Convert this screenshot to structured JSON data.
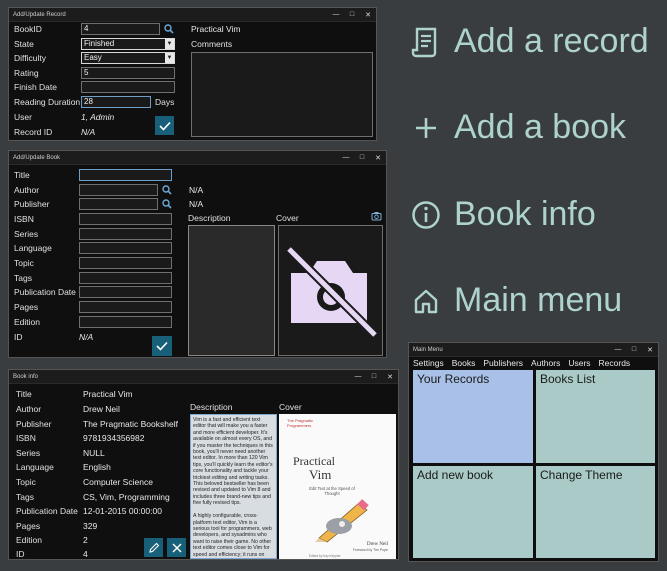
{
  "add_record": {
    "title": "Add/Update Record",
    "labels": {
      "bookid": "BookID",
      "state": "State",
      "difficulty": "Difficulty",
      "rating": "Rating",
      "finish_date": "Finish Date",
      "reading_duration": "Reading Duration",
      "user": "User",
      "record_id": "Record ID",
      "comments": "Comments",
      "days": "Days"
    },
    "values": {
      "bookid": "4",
      "state": "Finished",
      "difficulty": "Easy",
      "rating": "5",
      "finish_date": "",
      "reading_duration": "28",
      "user": "1, Admin",
      "record_id": "N/A",
      "book_title": "Practical Vim"
    }
  },
  "add_book": {
    "title": "Add/Update Book",
    "labels": {
      "title": "Title",
      "author": "Author",
      "publisher": "Publisher",
      "isbn": "ISBN",
      "series": "Series",
      "language": "Language",
      "topic": "Topic",
      "tags": "Tags",
      "publication_date": "Publication Date",
      "pages": "Pages",
      "edition": "Edition",
      "id": "ID",
      "description": "Description",
      "cover": "Cover"
    },
    "values": {
      "author_na": "N/A",
      "publisher_na": "N/A",
      "id": "N/A"
    }
  },
  "book_info": {
    "title": "Book info",
    "labels": {
      "title": "Title",
      "author": "Author",
      "publisher": "Publisher",
      "isbn": "ISBN",
      "series": "Series",
      "language": "Language",
      "topic": "Topic",
      "tags": "Tags",
      "publication_date": "Publication Date",
      "pages": "Pages",
      "edition": "Edition",
      "id": "ID",
      "description": "Description",
      "cover": "Cover"
    },
    "values": {
      "title": "Practical Vim",
      "author": "Drew Neil",
      "publisher": "The Pragmatic Bookshelf",
      "isbn": "9781934356982",
      "series": "NULL",
      "language": "English",
      "topic": "Computer Science",
      "tags": "CS, Vim, Programming",
      "publication_date": "12-01-2015 00:00:00",
      "pages": "329",
      "edition": "2",
      "id": "4"
    },
    "description": "Vim is a fast and efficient text editor that will make you a faster and more efficient developer. It's available on almost every OS, and if you master the techniques in this book, you'll never need another text editor. In more than 120 Vim tips, you'll quickly learn the editor's core functionality and tackle your trickiest editing and writing tasks. This beloved bestseller has been revised and updated to Vim 8 and includes three brand-new tips and five fully revised tips.\n\nA highly configurable, cross-platform text editor, Vim is a serious tool for programmers, web developers, and sysadmins who want to raise their game. No other text editor comes close to Vim for speed and efficiency; it runs on almost every system imaginable and supports most coding and markup languages.\n\nLearn how to edit text the \"Vim way\": complete a series of repetitive",
    "cover": {
      "brand": "The Pragmatic Programmers",
      "title_line1": "Practical",
      "title_line2": "Vim",
      "subtitle": "Edit Text at the Speed of Thought",
      "author": "Drew Neil",
      "foreword": "Foreword by Tim Pope",
      "editor": "Edited by Kay Keppler"
    }
  },
  "help": {
    "add_record": "Add a record",
    "add_book": "Add a book",
    "book_info": "Book info",
    "main_menu": "Main menu"
  },
  "main_menu": {
    "title": "Main Menu",
    "menu_items": [
      "Settings",
      "Books",
      "Publishers",
      "Authors",
      "Users",
      "Records"
    ],
    "tiles": {
      "your_records": "Your Records",
      "books_list": "Books List",
      "add_new_book": "Add new book",
      "change_theme": "Change Theme"
    }
  },
  "colors": {
    "accent_text": "#aed3cf",
    "tile_blue": "#a9c0e8",
    "tile_teal": "#a9cac6",
    "check_button": "#18607a",
    "no_image_icon": "#e6d8f4"
  },
  "window_controls": {
    "minimize": "—",
    "maximize": "□",
    "close": "✕"
  }
}
